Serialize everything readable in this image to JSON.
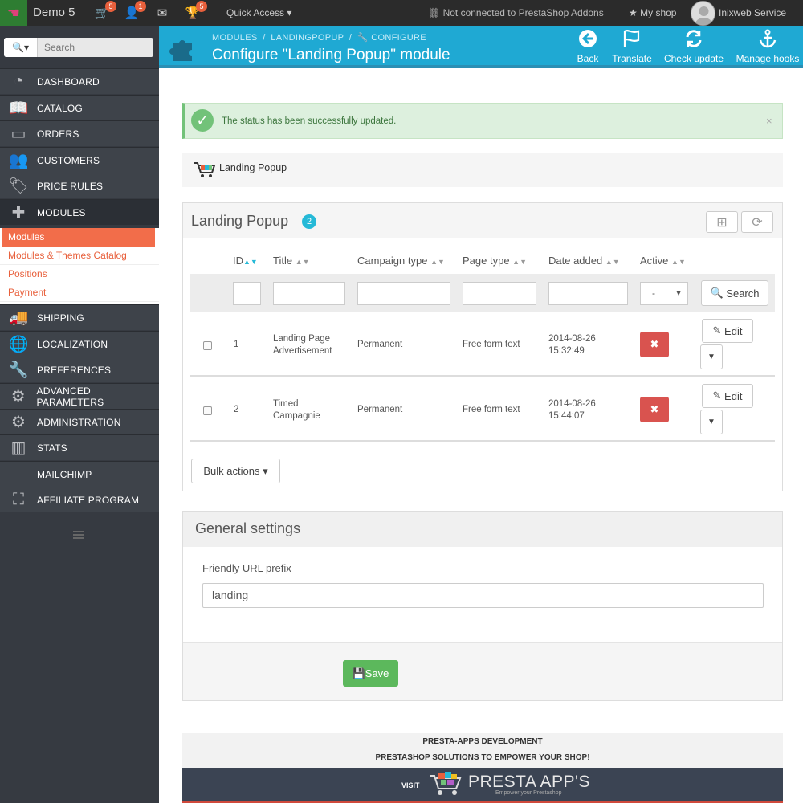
{
  "topbar": {
    "shop_name": "Demo 5",
    "badges": {
      "orders": "5",
      "customers": "1",
      "messages": "",
      "trophy": "5"
    },
    "quick_access": "Quick Access",
    "not_connected": "Not connected to PrestaShop Addons",
    "my_shop": "My shop",
    "employee": "Inixweb Service"
  },
  "sidebar": {
    "search_placeholder": "Search",
    "items": [
      {
        "label": "DASHBOARD",
        "icon": "dashboard-icon"
      },
      {
        "label": "CATALOG",
        "icon": "book-icon"
      },
      {
        "label": "ORDERS",
        "icon": "credit-card-icon"
      },
      {
        "label": "CUSTOMERS",
        "icon": "users-icon"
      },
      {
        "label": "PRICE RULES",
        "icon": "tags-icon"
      },
      {
        "label": "MODULES",
        "icon": "puzzle-icon"
      },
      {
        "label": "SHIPPING",
        "icon": "truck-icon"
      },
      {
        "label": "LOCALIZATION",
        "icon": "globe-icon"
      },
      {
        "label": "PREFERENCES",
        "icon": "wrench-icon"
      },
      {
        "label": "ADVANCED PARAMETERS",
        "icon": "cogs-icon"
      },
      {
        "label": "ADMINISTRATION",
        "icon": "cog-icon"
      },
      {
        "label": "STATS",
        "icon": "bar-chart-icon"
      },
      {
        "label": "MAILCHIMP",
        "icon": ""
      },
      {
        "label": "AFFILIATE PROGRAM",
        "icon": "sitemap-icon"
      }
    ],
    "submenu": [
      "Modules",
      "Modules & Themes Catalog",
      "Positions",
      "Payment"
    ]
  },
  "header": {
    "breadcrumb": [
      "MODULES",
      "LANDINGPOPUP",
      "CONFIGURE"
    ],
    "title": "Configure \"Landing Popup\" module",
    "buttons": [
      "Back",
      "Translate",
      "Check update",
      "Manage hooks"
    ]
  },
  "alert": {
    "message": "The status has been successfully updated.",
    "close": "×"
  },
  "module_bar": {
    "name": "Landing Popup"
  },
  "list_panel": {
    "title": "Landing Popup",
    "count": "2",
    "columns": [
      "ID",
      "Title",
      "Campaign type",
      "Page type",
      "Date added",
      "Active"
    ],
    "filter_select": "-",
    "search_label": "Search",
    "rows": [
      {
        "id": "1",
        "title_l1": "Landing Page",
        "title_l2": "Advertisement",
        "campaign": "Permanent",
        "page_type": "Free form text",
        "date": "2014-08-26",
        "time": "15:32:49",
        "edit": "Edit"
      },
      {
        "id": "2",
        "title_l1": "Timed",
        "title_l2": "Campagnie",
        "campaign": "Permanent",
        "page_type": "Free form text",
        "date": "2014-08-26",
        "time": "15:44:07",
        "edit": "Edit"
      }
    ],
    "bulk_label": "Bulk actions"
  },
  "settings_panel": {
    "title": "General settings",
    "field_label": "Friendly URL prefix",
    "field_value": "landing",
    "save_label": "Save"
  },
  "promo": {
    "line1": "PRESTA-APPS DEVELOPMENT",
    "line2": "PRESTASHOP SOLUTIONS TO EMPOWER YOUR SHOP!",
    "visit": "VISIT",
    "brand": "PRESTA APP'S",
    "tagline": "Empower your Prestashop"
  },
  "colors": {
    "header_bg": "#1fa9d3",
    "sidebar_bg": "#363a41",
    "active_submenu": "#f26d4a",
    "success": "#72c279",
    "danger": "#d9534f",
    "save": "#5cb85c"
  }
}
